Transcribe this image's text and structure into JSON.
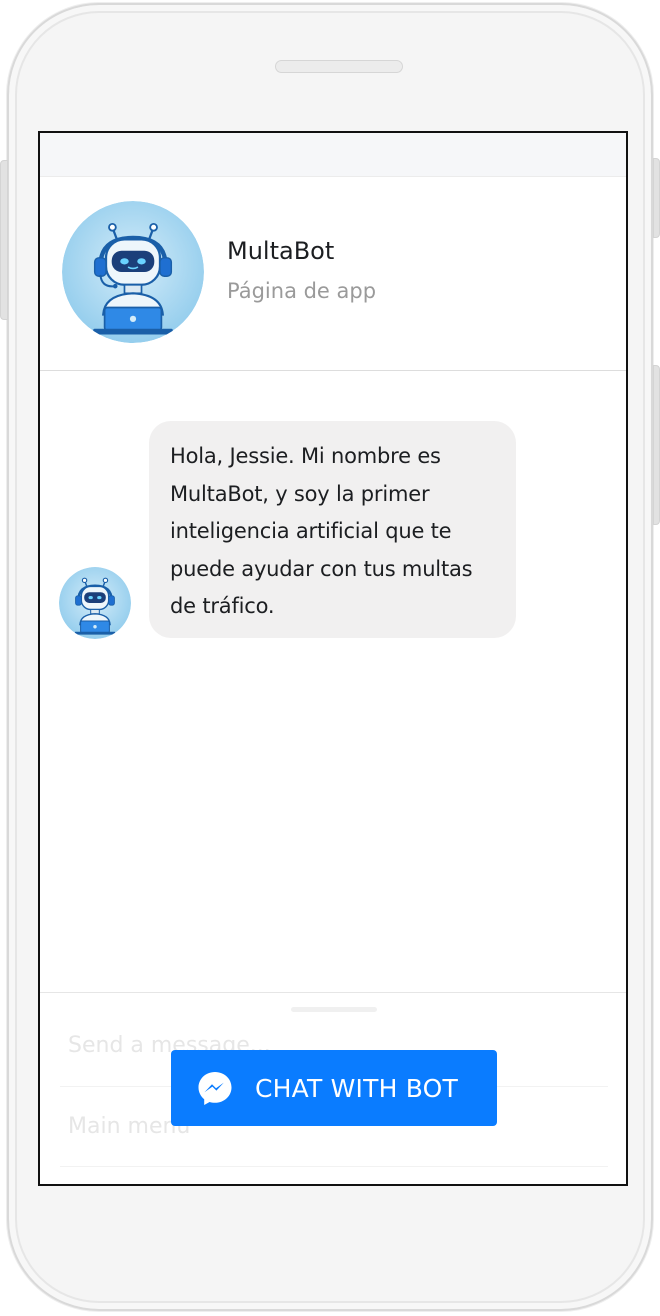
{
  "profile": {
    "name": "MultaBot",
    "subtitle": "Página de app",
    "avatar_icon": "robot-avatar-icon"
  },
  "message": {
    "text": "Hola, Jessie. Mi nombre es MultaBot, y soy la primer inteligencia artificial que te puede ayudar con tus multas de tráfico."
  },
  "composer": {
    "send_placeholder": "Send a message...",
    "menu_label": "Main menu"
  },
  "cta": {
    "label": "CHAT WITH BOT",
    "icon": "messenger-icon",
    "color": "#0a7cff"
  },
  "colors": {
    "bubble": "#f1f0f0",
    "accent": "#0a7cff"
  }
}
